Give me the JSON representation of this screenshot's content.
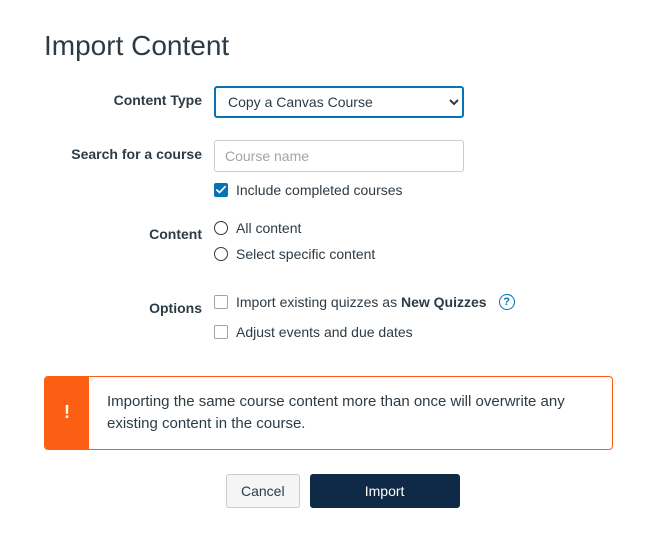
{
  "page_title": "Import Content",
  "labels": {
    "content_type": "Content Type",
    "search": "Search for a course",
    "content": "Content",
    "options": "Options"
  },
  "content_type": {
    "selected": "Copy a Canvas Course"
  },
  "search": {
    "placeholder": "Course name",
    "include_completed_label": "Include completed courses"
  },
  "content_radio": {
    "all": "All content",
    "select": "Select specific content"
  },
  "options": {
    "quizzes_prefix": "Import existing quizzes as ",
    "quizzes_bold": "New Quizzes",
    "adjust_dates": "Adjust events and due dates",
    "help_glyph": "?"
  },
  "alert": {
    "icon_glyph": "!",
    "text": "Importing the same course content more than once will overwrite any existing content in the course."
  },
  "buttons": {
    "cancel": "Cancel",
    "import": "Import"
  }
}
